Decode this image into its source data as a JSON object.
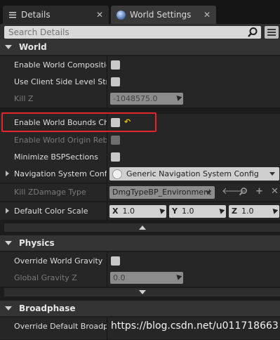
{
  "tabs": [
    {
      "label": "Details",
      "icon": "details-icon",
      "active": false
    },
    {
      "label": "World Settings",
      "icon": "globe-icon",
      "active": true
    }
  ],
  "search": {
    "placeholder": "Search Details"
  },
  "sections": {
    "world": {
      "title": "World",
      "rows": {
        "enable_world_composition": {
          "label": "Enable World Composition"
        },
        "use_client_side_level_streaming": {
          "label": "Use Client Side Level Stre"
        },
        "kill_z": {
          "label": "Kill Z",
          "value": "-1048575.0"
        },
        "enable_world_bounds_checks": {
          "label": "Enable World Bounds Chec"
        },
        "enable_world_origin_rebasing": {
          "label": "Enable World Origin Rebas"
        },
        "minimize_bsp_sections": {
          "label": "Minimize BSPSections"
        },
        "navigation_system_config": {
          "label": "Navigation System Config",
          "value": "Generic Navigation System Config"
        },
        "kill_z_damage_type": {
          "label": "Kill ZDamage Type",
          "value": "DmgTypeBP_Environment"
        },
        "default_color_scale": {
          "label": "Default Color Scale",
          "x_axis": "X",
          "x": "1.0",
          "y_axis": "Y",
          "y": "1.0",
          "z_axis": "Z",
          "z": "1.0"
        }
      }
    },
    "physics": {
      "title": "Physics",
      "rows": {
        "override_world_gravity": {
          "label": "Override World Gravity"
        },
        "global_gravity_z": {
          "label": "Global Gravity Z",
          "value": "0.0"
        }
      }
    },
    "broadphase": {
      "title": "Broadphase",
      "rows": {
        "override_default_broadphase": {
          "label": "Override Default Broadpha"
        }
      }
    }
  },
  "watermark": "https://blog.csdn.net/u011718663",
  "colors": {
    "highlight": "#e3262b",
    "reset_arrow": "#e4c100"
  }
}
